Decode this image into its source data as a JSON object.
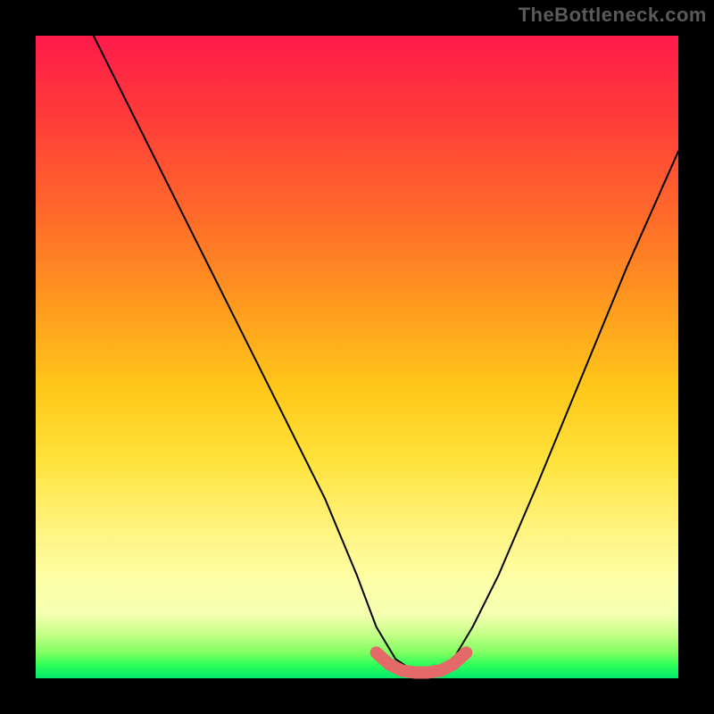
{
  "watermark": "TheBottleneck.com",
  "chart_data": {
    "type": "line",
    "title": "",
    "xlabel": "",
    "ylabel": "",
    "xlim": [
      0,
      100
    ],
    "ylim": [
      0,
      100
    ],
    "series": [
      {
        "name": "bottleneck-curve",
        "x": [
          9,
          15,
          22,
          30,
          38,
          45,
          50,
          53,
          56,
          59,
          62,
          65,
          68,
          72,
          78,
          85,
          92,
          100
        ],
        "y": [
          100,
          88,
          74,
          58,
          42,
          28,
          16,
          8,
          3,
          1,
          1,
          3,
          8,
          16,
          30,
          47,
          64,
          82
        ],
        "color": "#000000",
        "width": 2
      },
      {
        "name": "optimal-band",
        "x": [
          53,
          55,
          57,
          59,
          61,
          63,
          65,
          67
        ],
        "y": [
          4,
          2.2,
          1.2,
          0.9,
          0.9,
          1.2,
          2.2,
          4
        ],
        "color": "#e46a6a",
        "width": 14
      }
    ]
  }
}
